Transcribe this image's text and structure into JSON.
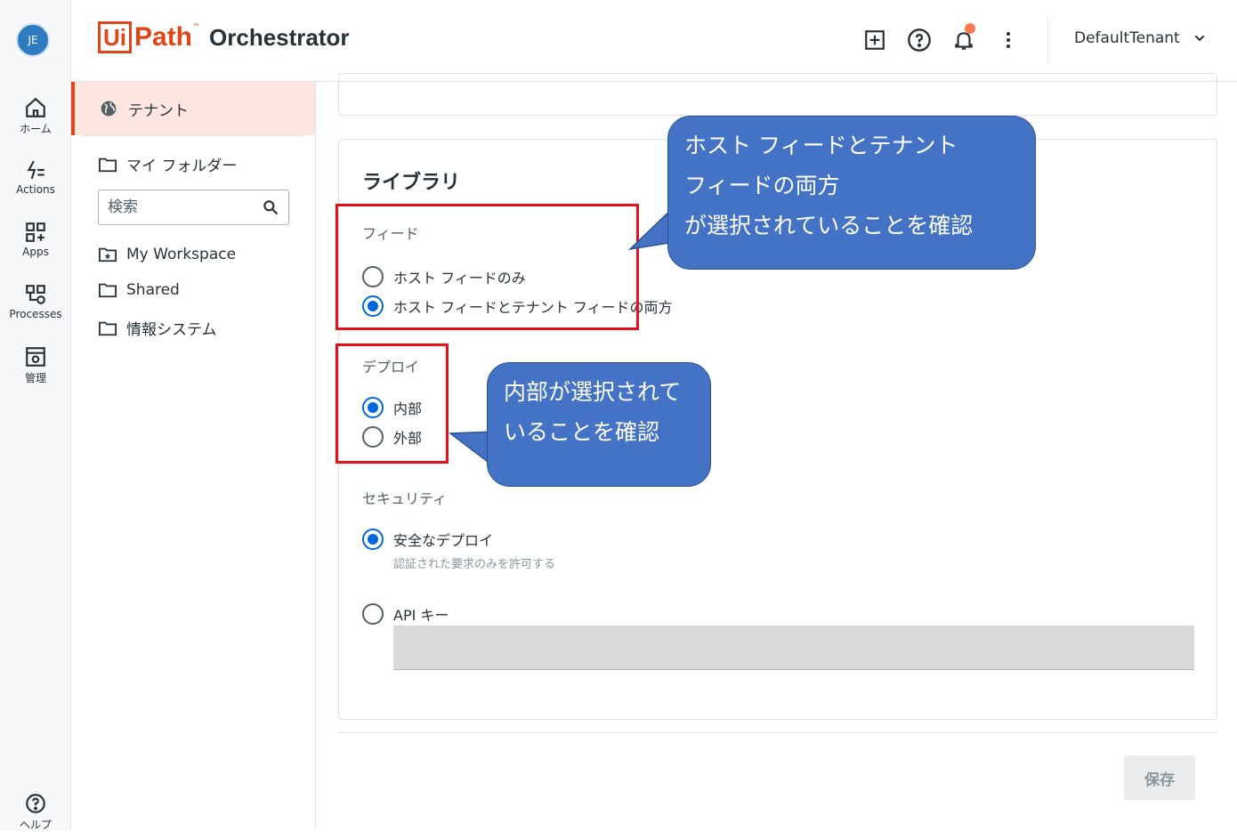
{
  "rail": {
    "avatar_initials": "JE",
    "items": [
      {
        "label": "ホーム"
      },
      {
        "label": "Actions"
      },
      {
        "label": "Apps"
      },
      {
        "label": "Processes"
      },
      {
        "label": "管理"
      }
    ],
    "help_label": "ヘルプ"
  },
  "header": {
    "logo_ui": "Ui",
    "logo_path": "Path",
    "logo_tm": "™",
    "app_name": "Orchestrator",
    "tenant_name": "DefaultTenant",
    "notification_dot_color": "#fa7b52"
  },
  "folders": {
    "tenant_label": "テナント",
    "my_folder_label": "マイ フォルダー",
    "search_placeholder": "検索",
    "items": [
      {
        "label": "My Workspace"
      },
      {
        "label": "Shared"
      },
      {
        "label": "情報システム"
      }
    ]
  },
  "library": {
    "title": "ライブラリ",
    "feed": {
      "label": "フィード",
      "options": [
        {
          "label": "ホスト フィードのみ",
          "selected": false
        },
        {
          "label": "ホスト フィードとテナント フィードの両方",
          "selected": true
        }
      ]
    },
    "deploy": {
      "label": "デプロイ",
      "options": [
        {
          "label": "内部",
          "selected": true
        },
        {
          "label": "外部",
          "selected": false
        }
      ]
    },
    "security": {
      "label": "セキュリティ",
      "secure_label": "安全なデプロイ",
      "secure_sub": "認証された要求のみを許可する",
      "secure_selected": true,
      "api_label": "API キー",
      "api_selected": false
    }
  },
  "save_label": "保存",
  "annotations": {
    "feed_callout": [
      "ホスト フィードとテナント",
      "フィードの両方",
      "が選択されていることを確認"
    ],
    "deploy_callout": [
      "内部が選択されて",
      "いることを確認"
    ],
    "callout_color": "#4472c4",
    "box_color": "#e8101a"
  }
}
